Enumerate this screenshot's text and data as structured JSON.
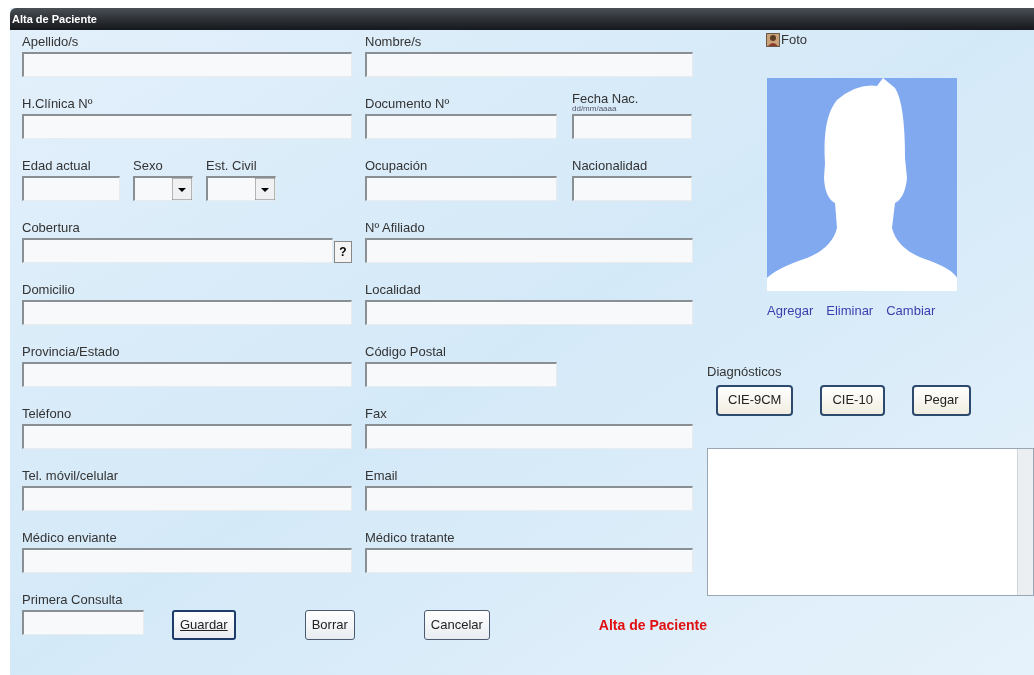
{
  "window": {
    "title": "Alta de Paciente"
  },
  "rows": [
    {
      "left": [
        {
          "label": "Apellido/s",
          "kind": "text"
        }
      ],
      "middle": [
        {
          "label": "Nombre/s",
          "kind": "text"
        }
      ]
    },
    {
      "left": [
        {
          "label": "H.Clínica Nº",
          "kind": "text"
        }
      ],
      "middle": [
        {
          "label": "Documento Nº",
          "kind": "text"
        },
        {
          "label": "Fecha Nac.",
          "hint": "dd/mm/aaaa",
          "kind": "text"
        }
      ]
    },
    {
      "left": [
        {
          "label": "Edad actual",
          "kind": "text"
        },
        {
          "label": "Sexo",
          "kind": "select"
        },
        {
          "label": "Est. Civil",
          "kind": "select"
        }
      ],
      "middle": [
        {
          "label": "Ocupación",
          "kind": "text"
        },
        {
          "label": "Nacionalidad",
          "kind": "text"
        }
      ]
    },
    {
      "left": [
        {
          "label": "Cobertura",
          "kind": "lookup",
          "button": "?"
        }
      ],
      "middle": [
        {
          "label": "Nº Afiliado",
          "kind": "text"
        }
      ]
    },
    {
      "left": [
        {
          "label": "Domicilio",
          "kind": "text"
        }
      ],
      "middle": [
        {
          "label": "Localidad",
          "kind": "text"
        }
      ]
    },
    {
      "left": [
        {
          "label": "Provincia/Estado",
          "kind": "text"
        }
      ],
      "middle": [
        {
          "label": "Código Postal",
          "kind": "short"
        }
      ]
    },
    {
      "left": [
        {
          "label": "Teléfono",
          "kind": "text"
        }
      ],
      "middle": [
        {
          "label": "Fax",
          "kind": "text"
        }
      ]
    },
    {
      "left": [
        {
          "label": "Tel. móvil/celular",
          "kind": "text"
        }
      ],
      "middle": [
        {
          "label": "Email",
          "kind": "text"
        }
      ]
    },
    {
      "left": [
        {
          "label": "Médico enviante",
          "kind": "text"
        }
      ],
      "middle": [
        {
          "label": "Médico tratante",
          "kind": "text"
        }
      ]
    }
  ],
  "first_visit": {
    "label": "Primera Consulta"
  },
  "photo": {
    "label": "Foto",
    "links": [
      "Agregar",
      "Eliminar",
      "Cambiar"
    ]
  },
  "diagnoses": {
    "label": "Diagnósticos",
    "buttons": [
      "CIE-9CM",
      "CIE-10",
      "Pegar"
    ]
  },
  "actions": [
    {
      "label": "Guardar",
      "default": true
    },
    {
      "label": "Borrar",
      "default": false
    },
    {
      "label": "Cancelar",
      "default": false
    }
  ],
  "status": "Alta de Paciente"
}
